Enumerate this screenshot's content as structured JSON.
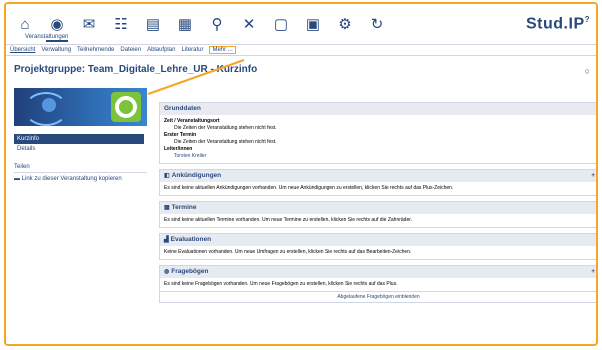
{
  "nav": {
    "caption": "Veranstaltungen",
    "icons": [
      "home-icon",
      "courses-icon",
      "mail-icon",
      "community-icon",
      "profile-icon",
      "planner-icon",
      "search-icon",
      "tools-icon",
      "files-icon",
      "workplace-icon",
      "admin-icon",
      "help-icon"
    ]
  },
  "logo": {
    "text": "Stud.IP",
    "superscript": "?"
  },
  "tabs": [
    "Übersicht",
    "Verwaltung",
    "Teilnehmende",
    "Dateien",
    "Ablaufplan",
    "Literatur",
    "Mehr ..."
  ],
  "page_title": "Projektgruppe: Team_Digitale_Lehre_UR - Kurzinfo",
  "sidebar": {
    "nav": [
      "Kurzinfo",
      "Details"
    ],
    "section_title": "Teilen",
    "share_link": "Link zu dieser Veranstaltung kopieren"
  },
  "grunddaten": {
    "title": "Grunddaten",
    "zeit_label": "Zeit / Veranstaltungsort",
    "zeit_value": "Die Zeiten der Veranstaltung stehen nicht fest.",
    "termin_label": "Erster Termin",
    "termin_value": "Die Zeiten der Veranstaltung stehen nicht fest.",
    "leitung_label": "Leiter/innen",
    "leitung_value": "Torsten Kreiler"
  },
  "panels": [
    {
      "key": "ankuendigungen",
      "title": "Ankündigungen",
      "icon": "megaphone-icon",
      "has_plus": true,
      "text": "Es sind keine aktuellen Ankündigungen vorhanden. Um neue Ankündigungen zu erstellen, klicken Sie rechts auf das Plus-Zeichen."
    },
    {
      "key": "termine",
      "title": "Termine",
      "icon": "calendar-icon",
      "has_plus": false,
      "text": "Es sind keine aktuellen Termine vorhanden. Um neue Termine zu erstellen, klicken Sie rechts auf die Zahnräder."
    },
    {
      "key": "evaluationen",
      "title": "Evaluationen",
      "icon": "chart-icon",
      "has_plus": false,
      "text": "Keine Evaluationen vorhanden. Um neue Umfragen zu erstellen, klicken Sie rechts auf das Bearbeiten-Zeichen."
    },
    {
      "key": "frageboegen",
      "title": "Fragebögen",
      "icon": "questionnaire-icon",
      "has_plus": true,
      "text": "Es sind keine Fragebögen vorhanden. Um neue Fragebögen zu erstellen, klicken Sie rechts auf das Plus."
    }
  ],
  "frageboegen_footer": "Abgelaufene Fragebögen einblenden",
  "colors": {
    "brand": "#28497c",
    "highlight": "#f5a623",
    "panel_header": "#e7ebf1"
  }
}
